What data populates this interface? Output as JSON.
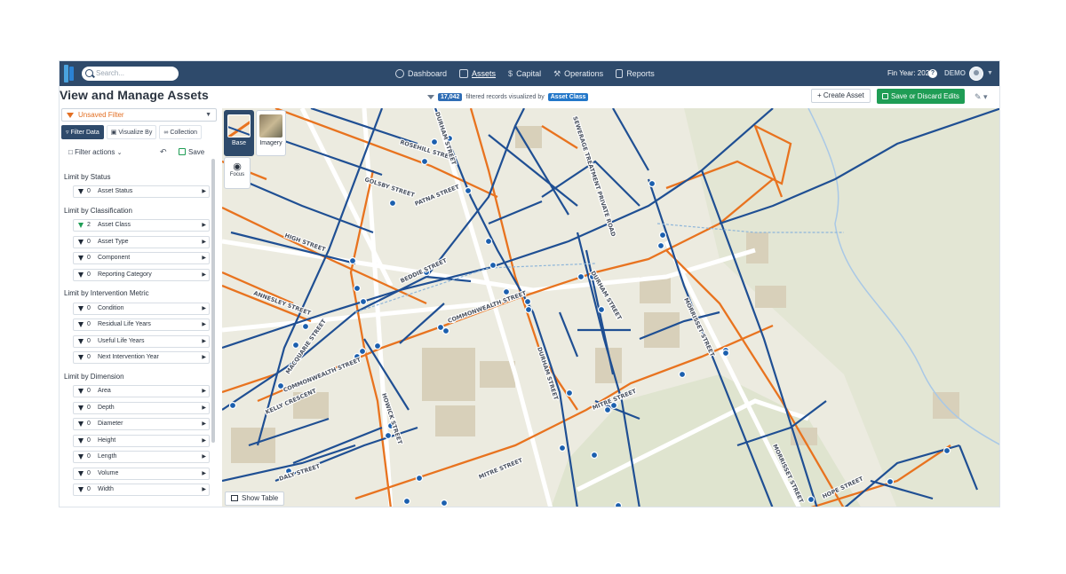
{
  "topbar": {
    "search_placeholder": "Search...",
    "nav": [
      {
        "label": "Dashboard",
        "icon": "dashboard-icon"
      },
      {
        "label": "Assets",
        "icon": "assets-icon",
        "active": true
      },
      {
        "label": "Capital",
        "icon": "dollar-icon"
      },
      {
        "label": "Operations",
        "icon": "wrench-icon"
      },
      {
        "label": "Reports",
        "icon": "document-icon"
      }
    ],
    "fin_year": "Fin Year: 2021",
    "user": "DEMO"
  },
  "header": {
    "title": "View and Manage Assets",
    "record_count": "17,042",
    "record_text": "filtered records visualized by",
    "visualized_by": "Asset Class",
    "create_label": "+ Create Asset",
    "save_label": "Save or Discard Edits"
  },
  "panel": {
    "filter_name": "Unsaved Filter",
    "tabs": [
      "Filter Data",
      "Visualize By",
      "Collection"
    ],
    "filter_actions": "Filter actions",
    "save_label": "Save",
    "groups": [
      {
        "title": "Limit by Status",
        "filters": [
          {
            "count": "0",
            "label": "Asset Status"
          }
        ]
      },
      {
        "title": "Limit by Classification",
        "filters": [
          {
            "count": "2",
            "label": "Asset Class",
            "active": true
          },
          {
            "count": "0",
            "label": "Asset Type"
          },
          {
            "count": "0",
            "label": "Component"
          },
          {
            "count": "0",
            "label": "Reporting Category"
          }
        ]
      },
      {
        "title": "Limit by Intervention Metric",
        "filters": [
          {
            "count": "0",
            "label": "Condition"
          },
          {
            "count": "0",
            "label": "Residual Life Years"
          },
          {
            "count": "0",
            "label": "Useful Life Years"
          },
          {
            "count": "0",
            "label": "Next Intervention Year"
          }
        ]
      },
      {
        "title": "Limit by Dimension",
        "filters": [
          {
            "count": "0",
            "label": "Area"
          },
          {
            "count": "0",
            "label": "Depth"
          },
          {
            "count": "0",
            "label": "Diameter"
          },
          {
            "count": "0",
            "label": "Height"
          },
          {
            "count": "0",
            "label": "Length"
          },
          {
            "count": "0",
            "label": "Volume"
          },
          {
            "count": "0",
            "label": "Width"
          }
        ]
      }
    ]
  },
  "map": {
    "layers": {
      "base": "Base",
      "imagery": "Imagery",
      "focus": "Focus"
    },
    "show_table": "Show Table",
    "streets": [
      "ROSEHILL STREET",
      "GOLSBY STREET",
      "PATNA STREET",
      "HIGH STREET",
      "BEDDIE STREET",
      "ANNESLEY STREET",
      "COMMONWEALTH STREET",
      "COMMONWEALTH STREET",
      "KELLY CRESCENT",
      "HOWICK STREET",
      "DALY STREET",
      "MITRE STREET",
      "MITRE STREET",
      "DURHAM STREET",
      "MORRISSET STREET",
      "MORRISSET STREET",
      "HOPE STREET",
      "SEWERAGE TREATMENT PRIVATE ROAD",
      "DURHAM STREET",
      "MACQUARIE STREET",
      "DURHAM STREET"
    ],
    "colors": {
      "water": "#1f4f93",
      "sewer": "#e8731f",
      "node": "#1b5fae",
      "building": "#d8d0ba",
      "river": "#a9c8e6",
      "park": "#e3e6d4"
    }
  }
}
